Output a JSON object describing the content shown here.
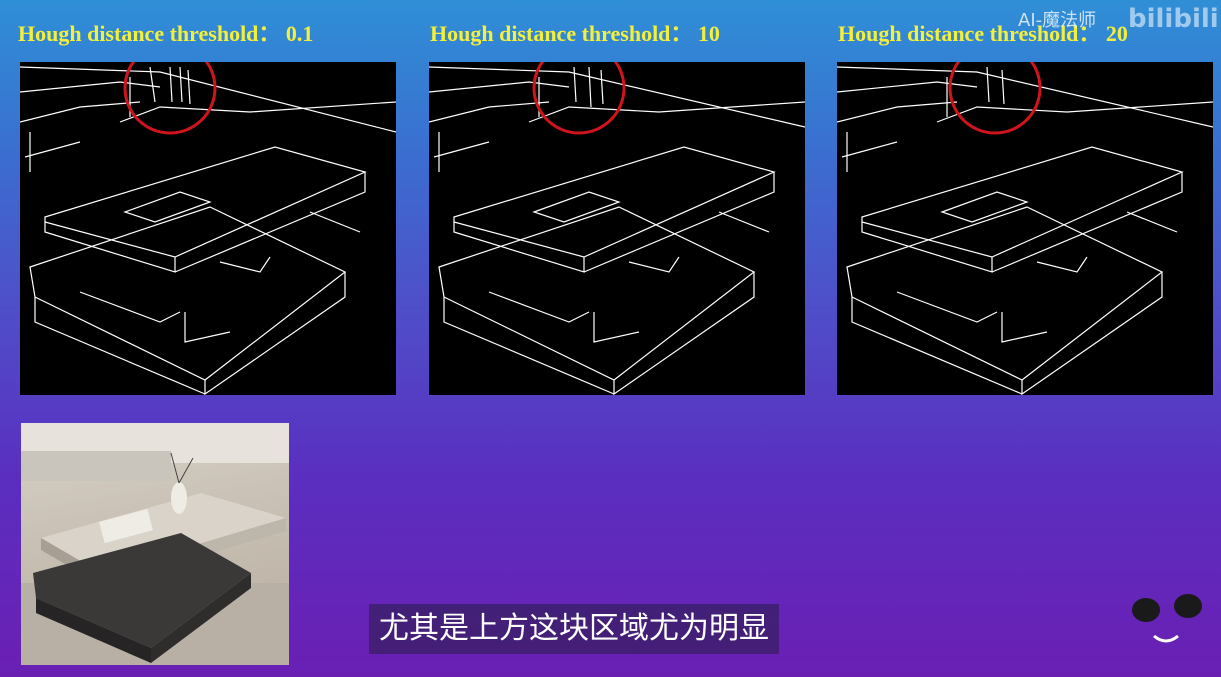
{
  "panels": [
    {
      "title": "Hough distance threshold：  0.1"
    },
    {
      "title": "Hough distance threshold：  10"
    },
    {
      "title": "Hough distance threshold：  20"
    }
  ],
  "subtitle": "尤其是上方这块区域尤为明显",
  "watermark": {
    "text": "AI-魔法师",
    "logo": "bilibili"
  },
  "colors": {
    "title": "#f4ef3a",
    "circle": "#d0141c",
    "background_top": "#2f8fd6",
    "background_bottom": "#6a1fb3"
  }
}
